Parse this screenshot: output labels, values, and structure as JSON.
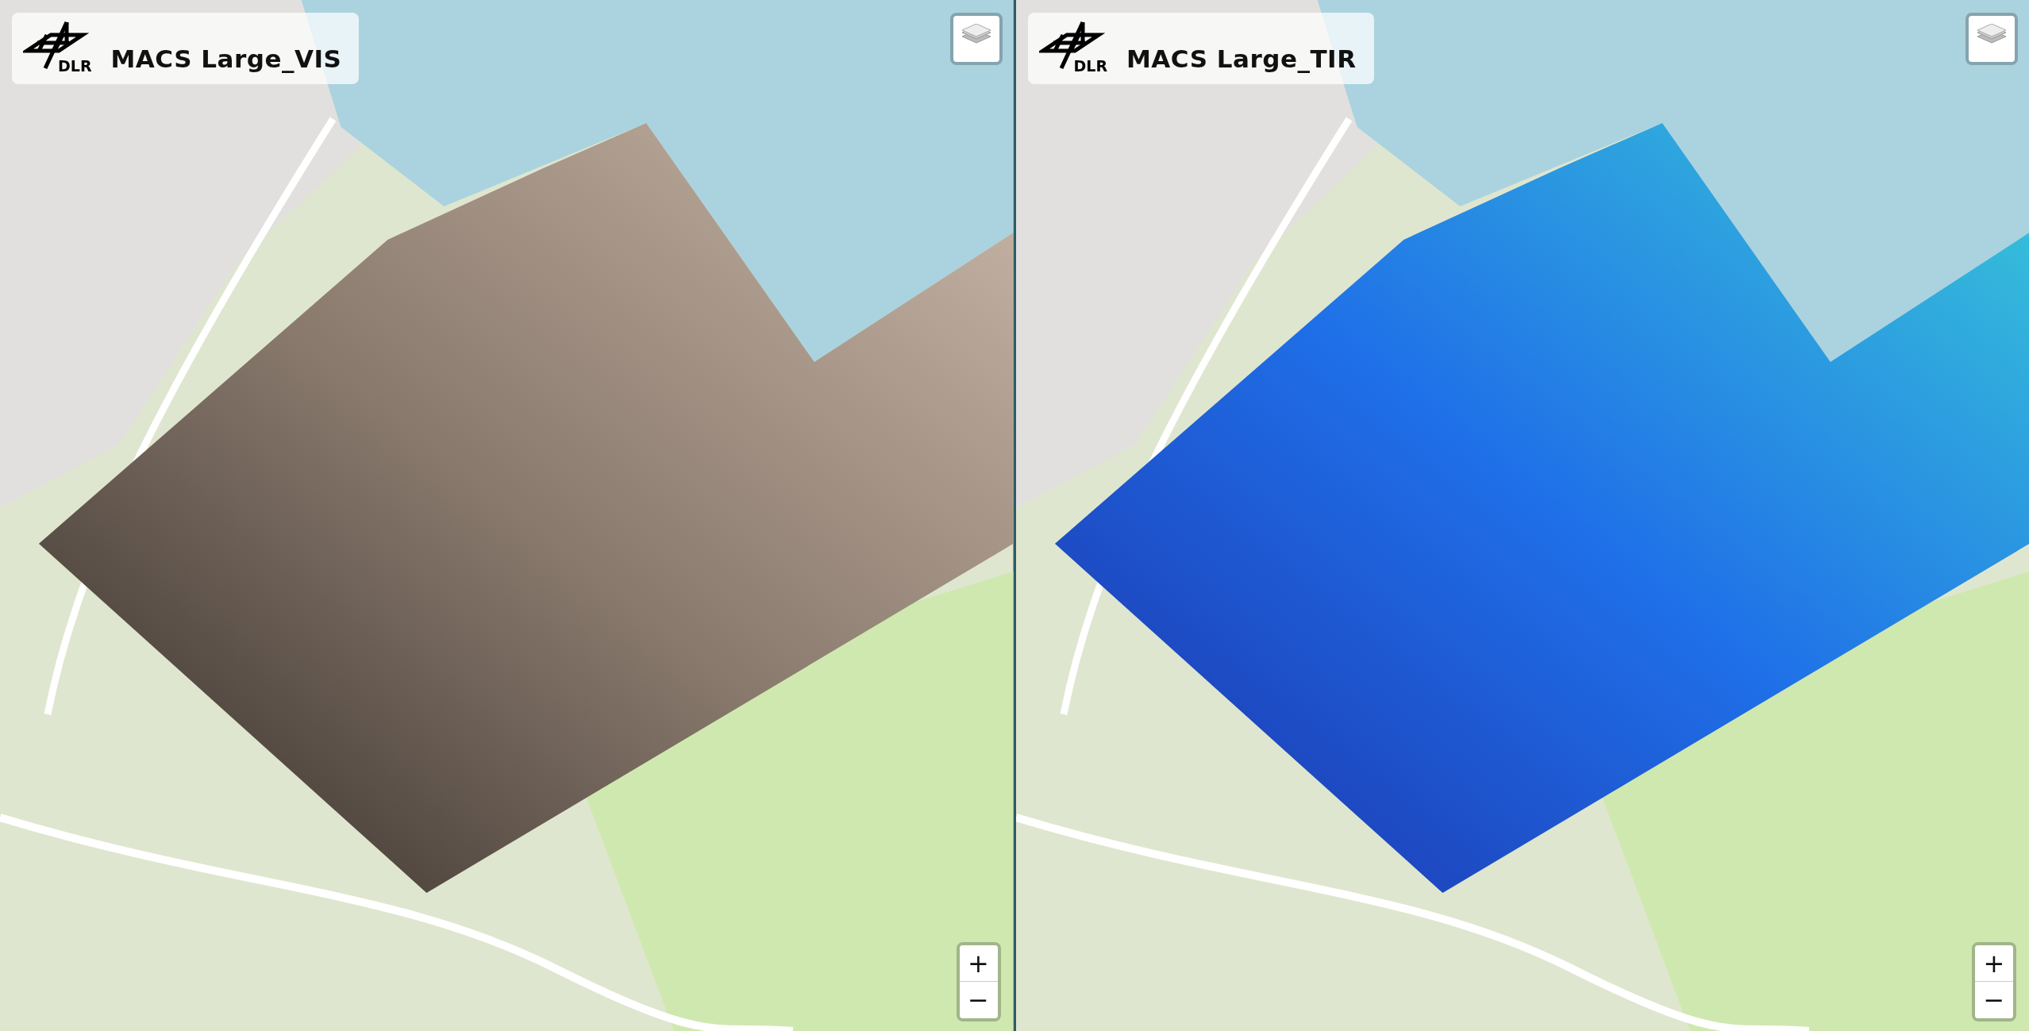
{
  "panels": [
    {
      "logo_text": "DLR",
      "title": "MACS Large_VIS",
      "imagery": {
        "kind": "visible"
      },
      "zoom_in": "+",
      "zoom_out": "−"
    },
    {
      "logo_text": "DLR",
      "title": "MACS Large_TIR",
      "imagery": {
        "kind": "thermal"
      },
      "zoom_in": "+",
      "zoom_out": "−"
    }
  ]
}
